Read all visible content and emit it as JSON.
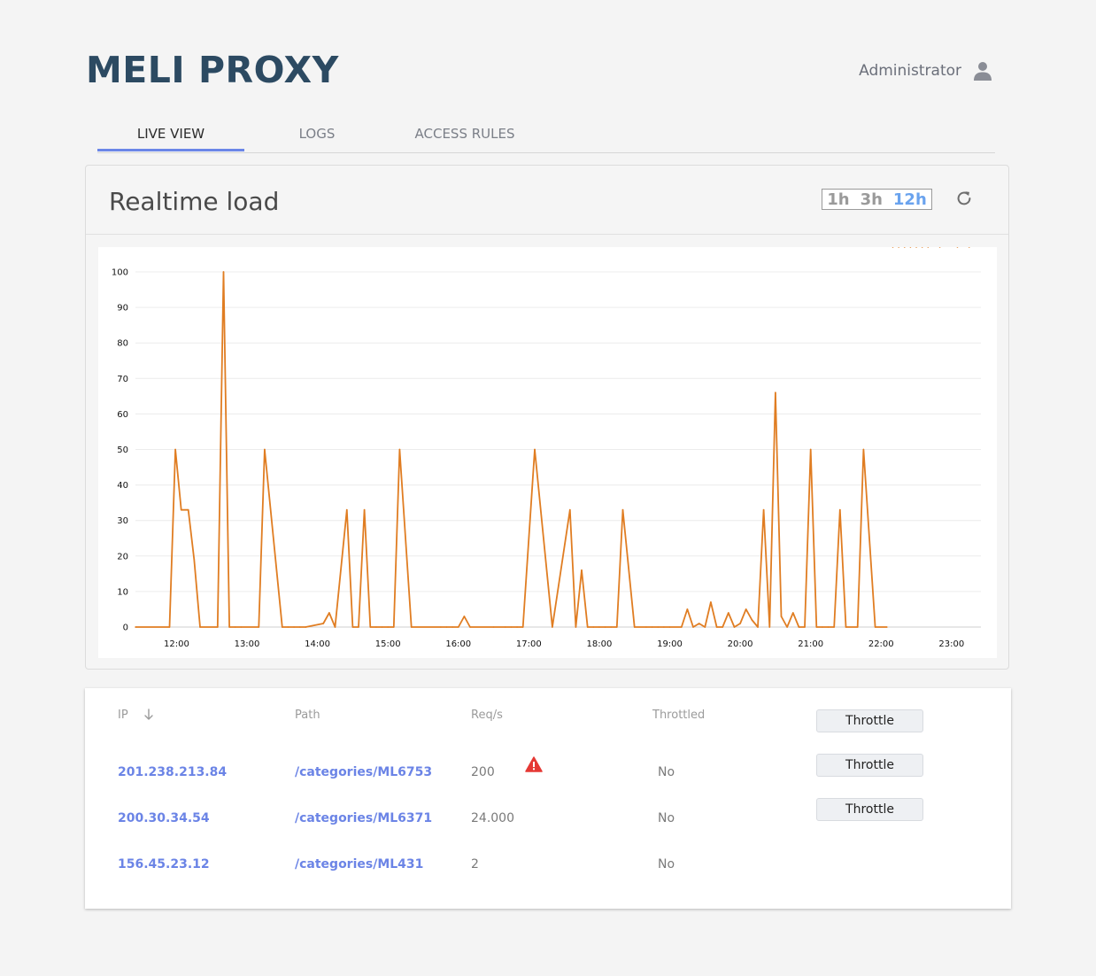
{
  "app": {
    "title": "MELI PROXY"
  },
  "user": {
    "name": "Administrator",
    "icon": "user-icon"
  },
  "tabs": [
    {
      "label": "LIVE VIEW",
      "active": true
    },
    {
      "label": "LOGS",
      "active": false
    },
    {
      "label": "ACCESS RULES",
      "active": false
    }
  ],
  "load": {
    "title": "Realtime load",
    "ranges": [
      {
        "label": "1h",
        "active": false
      },
      {
        "label": "3h",
        "active": false
      },
      {
        "label": "12h",
        "active": true
      }
    ],
    "refresh_icon": "refresh-icon"
  },
  "chart_data": {
    "type": "line",
    "title": "",
    "xlabel": "",
    "ylabel": "",
    "ylim": [
      0,
      100
    ],
    "yticks": [
      "0",
      "10",
      "20",
      "30",
      "40",
      "50",
      "60",
      "70",
      "80",
      "90",
      "100"
    ],
    "xticks": [
      "12:00",
      "13:00",
      "14:00",
      "15:00",
      "16:00",
      "17:00",
      "18:00",
      "19:00",
      "20:00",
      "21:00",
      "22:00",
      "23:00"
    ],
    "grid": true,
    "color": "#e07d22",
    "x": [
      "11:25",
      "11:54",
      "11:59",
      "12:04",
      "12:10",
      "12:15",
      "12:20",
      "12:35",
      "12:40",
      "12:45",
      "12:50",
      "12:55",
      "13:10",
      "13:15",
      "13:30",
      "13:35",
      "13:40",
      "13:45",
      "13:50",
      "14:05",
      "14:10",
      "14:15",
      "14:25",
      "14:30",
      "14:35",
      "14:40",
      "14:45",
      "14:50",
      "14:55",
      "15:00",
      "15:05",
      "15:10",
      "15:20",
      "15:45",
      "15:50",
      "15:55",
      "16:00",
      "16:05",
      "16:10",
      "16:30",
      "16:40",
      "16:45",
      "16:50",
      "16:55",
      "17:05",
      "17:20",
      "17:35",
      "17:40",
      "17:45",
      "17:50",
      "17:55",
      "18:00",
      "18:05",
      "18:10",
      "18:15",
      "18:20",
      "18:30",
      "18:40",
      "18:45",
      "18:50",
      "18:55",
      "19:00",
      "19:10",
      "19:15",
      "19:20",
      "19:25",
      "19:30",
      "19:35",
      "19:40",
      "19:45",
      "19:50",
      "19:55",
      "20:00",
      "20:05",
      "20:10",
      "20:15",
      "20:20",
      "20:25",
      "20:30",
      "20:35",
      "20:40",
      "20:45",
      "20:50",
      "20:55",
      "21:00",
      "21:05",
      "21:10",
      "21:15",
      "21:20",
      "21:25",
      "21:30",
      "21:40",
      "21:45",
      "21:55",
      "22:05",
      "22:10",
      "22:15",
      "22:20",
      "22:25",
      "22:30",
      "22:35",
      "22:40",
      "22:50",
      "23:05",
      "23:15"
    ],
    "series": [
      {
        "values": [
          0,
          0,
          50,
          33,
          33,
          19,
          0,
          0,
          100,
          0,
          0,
          0,
          0,
          50,
          0,
          0,
          0,
          0,
          0,
          1,
          4,
          0,
          33,
          0,
          0,
          33,
          0,
          0,
          0,
          0,
          0,
          50,
          0,
          0,
          0,
          0,
          0,
          3,
          0,
          0,
          0,
          0,
          0,
          0,
          50,
          0,
          33,
          0,
          16,
          0,
          0,
          0,
          0,
          0,
          0,
          33,
          0,
          0,
          0,
          0,
          0,
          0,
          0,
          5,
          0,
          1,
          0,
          7,
          0,
          0,
          4,
          0,
          1,
          5,
          2,
          0,
          33,
          0,
          66,
          3,
          0,
          4,
          0,
          0,
          50,
          0,
          0,
          0,
          0,
          33,
          0,
          0,
          50,
          0,
          0
        ]
      }
    ]
  },
  "table": {
    "headers": {
      "ip": "IP",
      "path": "Path",
      "req": "Req/s",
      "throttled": "Throttled"
    },
    "sort_icon": "arrow-down-icon",
    "action_label": "Throttle",
    "rows": [
      {
        "ip": "201.238.213.84",
        "path": "/categories/ML6753",
        "req": "200",
        "throttled": "No",
        "warning": true
      },
      {
        "ip": "200.30.34.54",
        "path": "/categories/ML6371",
        "req": "24.000",
        "throttled": "No",
        "warning": false
      },
      {
        "ip": "156.45.23.12",
        "path": "/categories/ML431",
        "req": "2",
        "throttled": "No",
        "warning": false
      }
    ],
    "throttle_buttons": [
      "Throttle",
      "Throttle",
      "Throttle"
    ],
    "warning_icon": "warning-icon",
    "warning_color": "#e53935"
  },
  "colors": {
    "brand": "#2c4a62",
    "accent": "#6b86e8",
    "link": "#6b84e6",
    "line": "#e07d22"
  }
}
